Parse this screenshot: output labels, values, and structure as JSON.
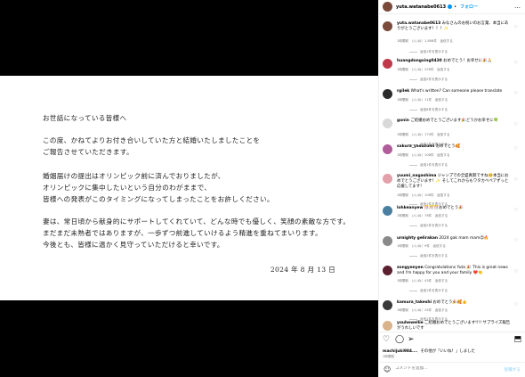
{
  "letter": {
    "lines": [
      "お世話になっている皆様へ",
      "この度、かねてよりお付き合いしていた方と結婚いたしましたことを",
      "ご報告させていただきます。",
      "婚姻届けの提出はオリンピック前に済んでおりましたが、",
      "オリンピックに集中したいという自分のわがままで、",
      "皆様への発表がこのタイミングになってしまったことをお許しください。",
      "妻は、常日頃から献身的にサポートしてくれていて、どんな時でも優しく、笑顔の素敵な方です。",
      "まだまだ未熟者ではありますが、一歩ずつ前進していけるよう精進を重ねてまいります。",
      "今後とも、皆様に温かく見守っていただけると幸いです。"
    ],
    "date": "2024 年 8 月 13 日"
  },
  "header": {
    "username": "yuta.watanabe0613",
    "follow_label": "フォロー",
    "more_icon": "…"
  },
  "comments": [
    {
      "username": "yuta.watanabe0613",
      "text": "みなさんのお祝いのお言葉、本当にありがとうございます！！！✨",
      "meta": "1時間前　いいね！1,808件　返信する",
      "replies": "返信1件を表示する"
    },
    {
      "username": "huangdongxing0430",
      "text": "おめでとう！お幸せに🎉🙏",
      "meta": "1時間前　いいね！226件　返信する",
      "replies": "返信2件を表示する"
    },
    {
      "username": "rgilek",
      "text": "What's written? Can someone please translate",
      "meta": "1時間前　いいね！11件　返信する",
      "replies": "返信6件を表示する"
    },
    {
      "username": "gonin",
      "text": "ご結婚おめでとうございます🎉どうかお幸せに🍀",
      "meta": "1時間前　いいね！170件　返信する",
      "replies": "返信1件を表示する"
    },
    {
      "username": "sakura_yasuzumi",
      "text": "おめでとう🥰",
      "meta": "1時間前　いいね！106件　返信する",
      "replies": "返信1件を表示する"
    },
    {
      "username": "yuumi_nagashima",
      "text": "ジャンプでの全盛真期ですね🥺本当におめでとうございます！✨ そしてこれからもワタカベペアずっと応援してます！",
      "meta": "1時間前　いいね！108件　返信する",
      "replies": "返信1件を表示する"
    },
    {
      "username": "lohkeanyew",
      "text": "🎊🎊🎊おめでとう🎉",
      "meta": "1時間前　いいね！76件　返信する",
      "replies": "返信2件を表示する"
    },
    {
      "username": "urnighty gelirakan",
      "text": "2024 gak mam mam😍🔥",
      "meta": "1時間前　いいね！9件　返信する",
      "replies": "返信2件を表示する"
    },
    {
      "username": "zongyenyen",
      "text": "Congratulations Yuta 🎉 This is great news and I'm happy for you and your family ❤️👏",
      "meta": "1時間前　いいね！43件　返信する",
      "replies": "返信1件を表示する"
    },
    {
      "username": "kamura_takeshi",
      "text": "おめでとう🎉🥰👍",
      "meta": "1時間前　いいね！24件　返信する",
      "replies": "返信1件を表示する"
    },
    {
      "username": "youhewellie",
      "text": "ご結婚おめでとうございます!!!! サプライズ報告がうれしいです",
      "meta": "",
      "replies": ""
    }
  ],
  "actions": {
    "like_icon": "♡",
    "comment_icon": "◯",
    "share_icon": "➢",
    "save_icon": "⬒"
  },
  "likes": {
    "user": "machijuki984...",
    "text": "その他が「いいね！」しました"
  },
  "post_date": "1時間前",
  "composer": {
    "emoji_icon": "☺",
    "placeholder": "コメントを追加...",
    "post_label": "投稿する"
  },
  "colors": {
    "accent": "#0095f6",
    "meta_text": "#737373"
  }
}
